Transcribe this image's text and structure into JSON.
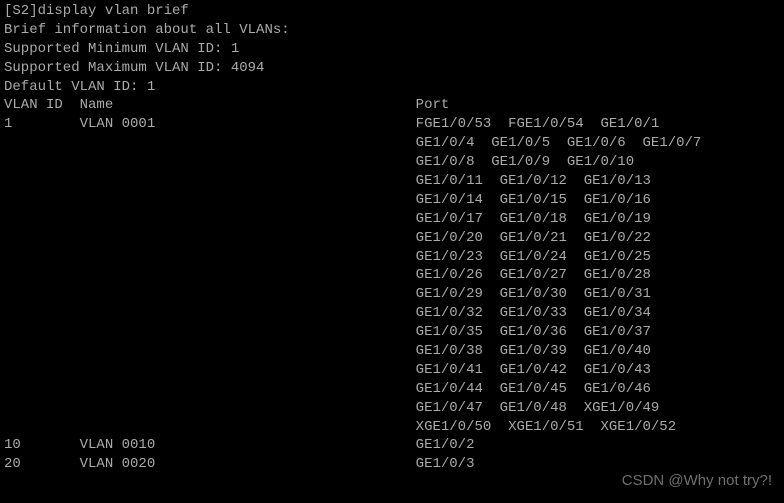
{
  "prompt": "[S2]",
  "command": "display vlan brief",
  "header_lines": [
    "Brief information about all VLANs:",
    "Supported Minimum VLAN ID: 1",
    "Supported Maximum VLAN ID: 4094",
    "Default VLAN ID: 1"
  ],
  "columns": {
    "c1": "VLAN ID",
    "c2": "Name",
    "c3": "Port"
  },
  "vlans": [
    {
      "id": "1",
      "name": "VLAN 0001",
      "port_rows": [
        "FGE1/0/53  FGE1/0/54  GE1/0/1",
        "GE1/0/4  GE1/0/5  GE1/0/6  GE1/0/7",
        "GE1/0/8  GE1/0/9  GE1/0/10",
        "GE1/0/11  GE1/0/12  GE1/0/13",
        "GE1/0/14  GE1/0/15  GE1/0/16",
        "GE1/0/17  GE1/0/18  GE1/0/19",
        "GE1/0/20  GE1/0/21  GE1/0/22",
        "GE1/0/23  GE1/0/24  GE1/0/25",
        "GE1/0/26  GE1/0/27  GE1/0/28",
        "GE1/0/29  GE1/0/30  GE1/0/31",
        "GE1/0/32  GE1/0/33  GE1/0/34",
        "GE1/0/35  GE1/0/36  GE1/0/37",
        "GE1/0/38  GE1/0/39  GE1/0/40",
        "GE1/0/41  GE1/0/42  GE1/0/43",
        "GE1/0/44  GE1/0/45  GE1/0/46",
        "GE1/0/47  GE1/0/48  XGE1/0/49",
        "XGE1/0/50  XGE1/0/51  XGE1/0/52"
      ]
    },
    {
      "id": "10",
      "name": "VLAN 0010",
      "port_rows": [
        "GE1/0/2"
      ]
    },
    {
      "id": "20",
      "name": "VLAN 0020",
      "port_rows": [
        "GE1/0/3"
      ]
    }
  ],
  "watermark": "CSDN @Why not try?!",
  "col_widths": {
    "id": 9,
    "name": 40
  }
}
